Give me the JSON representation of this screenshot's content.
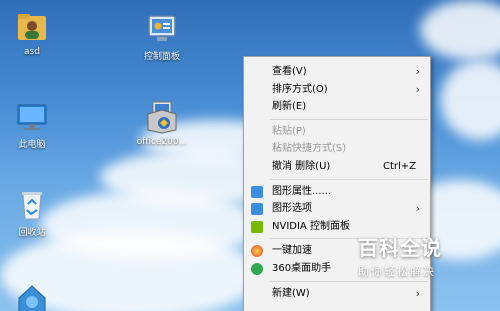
{
  "desktop": {
    "icons": [
      {
        "label": "asd"
      },
      {
        "label": "控制面板"
      },
      {
        "label": "此电脑"
      },
      {
        "label": "office200..."
      },
      {
        "label": "回收站"
      },
      {
        "label": ""
      }
    ]
  },
  "context_menu": {
    "view": {
      "label": "查看(V)"
    },
    "sort": {
      "label": "排序方式(O)"
    },
    "refresh": {
      "label": "刷新(E)"
    },
    "paste": {
      "label": "粘贴(P)"
    },
    "paste_shortcut": {
      "label": "粘贴快捷方式(S)"
    },
    "undo_delete": {
      "label": "撤消 删除(U)",
      "shortcut": "Ctrl+Z"
    },
    "graphics_properties": {
      "label": "图形属性......"
    },
    "graphics_options": {
      "label": "图形选项"
    },
    "nvidia": {
      "label": "NVIDIA 控制面板"
    },
    "speedup": {
      "label": "一键加速"
    },
    "desk_helper": {
      "label": "360桌面助手"
    },
    "more": {
      "label": "新建(W)"
    }
  },
  "watermark": {
    "title": "百科全说",
    "subtitle": "助你轻松解决"
  }
}
